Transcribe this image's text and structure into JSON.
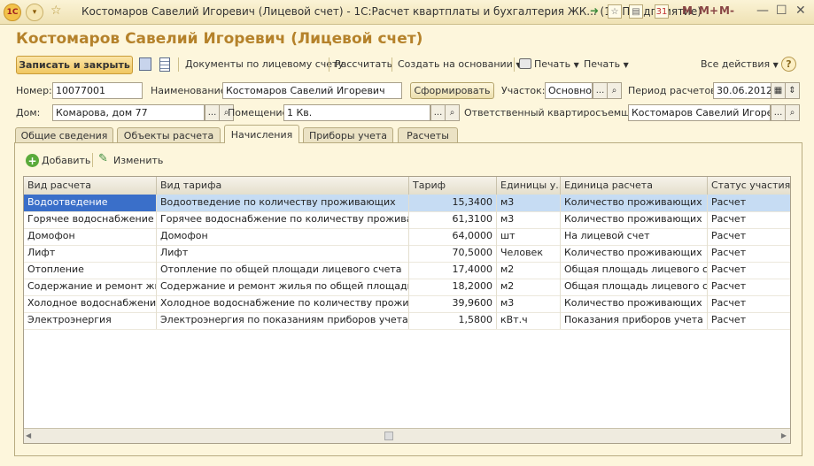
{
  "window": {
    "title": "Костомаров Савелий Игоревич (Лицевой счет) - 1С:Расчет квартплаты и бухгалтерия ЖК... (1С:Предприятие)",
    "m_buttons": [
      "M",
      "M+",
      "M-"
    ]
  },
  "form": {
    "title": "Костомаров Савелий Игоревич (Лицевой счет)"
  },
  "toolbar": {
    "save_close": "Записать и закрыть",
    "documents": "Документы по лицевому счету",
    "calculate": "Рассчитать",
    "create_based": "Создать на основании",
    "print1": "Печать",
    "print2": "Печать",
    "all_actions": "Все действия",
    "help": "?"
  },
  "fields": {
    "number_label": "Номер:",
    "number_value": "10077001",
    "name_label": "Наименование:",
    "name_value": "Костомаров Савелий Игоревич",
    "generate_button": "Сформировать",
    "district_label": "Участок:",
    "district_value": "Основной",
    "period_label": "Период расчетов:",
    "period_value": "30.06.2012",
    "house_label": "Дом:",
    "house_value": "Комарова, дом 77",
    "room_label": "Помещение:",
    "room_value": "1 Кв.",
    "tenant_label": "Ответственный квартиросъемщик:",
    "tenant_value": "Костомаров Савелий Игоревич"
  },
  "tabs": [
    {
      "label": "Общие сведения"
    },
    {
      "label": "Объекты расчета"
    },
    {
      "label": "Начисления"
    },
    {
      "label": "Приборы учета"
    },
    {
      "label": "Расчеты"
    }
  ],
  "active_tab": "Начисления",
  "panel_toolbar": {
    "add": "Добавить",
    "edit": "Изменить"
  },
  "table": {
    "columns": [
      "Вид расчета",
      "Вид тарифа",
      "Тариф",
      "Единицы у...",
      "Единица расчета",
      "Статус участия в р"
    ],
    "rows": [
      [
        "Водоотведение",
        "Водоотведение по количеству проживающих",
        "15,3400",
        "м3",
        "Количество проживающих",
        "Расчет"
      ],
      [
        "Горячее водоснабжение",
        "Горячее водоснабжение по количеству проживающих",
        "61,3100",
        "м3",
        "Количество проживающих",
        "Расчет"
      ],
      [
        "Домофон",
        "Домофон",
        "64,0000",
        "шт",
        "На лицевой счет",
        "Расчет"
      ],
      [
        "Лифт",
        "Лифт",
        "70,5000",
        "Человек",
        "Количество проживающих",
        "Расчет"
      ],
      [
        "Отопление",
        "Отопление по общей площади лицевого счета",
        "17,4000",
        "м2",
        "Общая площадь лицевого сч...",
        "Расчет"
      ],
      [
        "Содержание и ремонт жил...",
        "Содержание и ремонт жилья по общей площади лиц...",
        "18,2000",
        "м2",
        "Общая площадь лицевого сч...",
        "Расчет"
      ],
      [
        "Холодное водоснабжение",
        "Холодное водоснабжение по количеству проживаю...",
        "39,9600",
        "м3",
        "Количество проживающих",
        "Расчет"
      ],
      [
        "Электроэнергия",
        "Электроэнергия по показаниям приборов учета",
        "1,5800",
        "кВт.ч",
        "Показания приборов учета в ...",
        "Расчет"
      ]
    ]
  },
  "colors": {
    "title": "#b5822b",
    "selection": "#3a6fc9"
  }
}
